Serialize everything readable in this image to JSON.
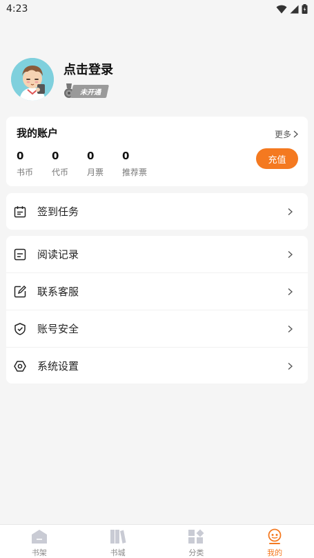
{
  "status_bar": {
    "time": "4:23"
  },
  "profile": {
    "login_text": "点击登录",
    "vip_status": "未开通"
  },
  "account": {
    "title": "我的账户",
    "more": "更多",
    "recharge": "充值",
    "stats": [
      {
        "value": "0",
        "label": "书币"
      },
      {
        "value": "0",
        "label": "代币"
      },
      {
        "value": "0",
        "label": "月票"
      },
      {
        "value": "0",
        "label": "推荐票"
      }
    ]
  },
  "menu": {
    "checkin": "签到任务",
    "items": [
      {
        "label": "阅读记录",
        "icon": "reading-record-icon"
      },
      {
        "label": "联系客服",
        "icon": "customer-service-icon"
      },
      {
        "label": "账号安全",
        "icon": "shield-icon"
      },
      {
        "label": "系统设置",
        "icon": "settings-icon"
      }
    ]
  },
  "tabbar": {
    "tabs": [
      {
        "label": "书架",
        "icon": "bookshelf-icon"
      },
      {
        "label": "书城",
        "icon": "bookstore-icon"
      },
      {
        "label": "分类",
        "icon": "category-icon"
      },
      {
        "label": "我的",
        "icon": "profile-icon",
        "active": true
      }
    ]
  },
  "colors": {
    "accent": "#f47920",
    "background": "#f5f5f5"
  }
}
